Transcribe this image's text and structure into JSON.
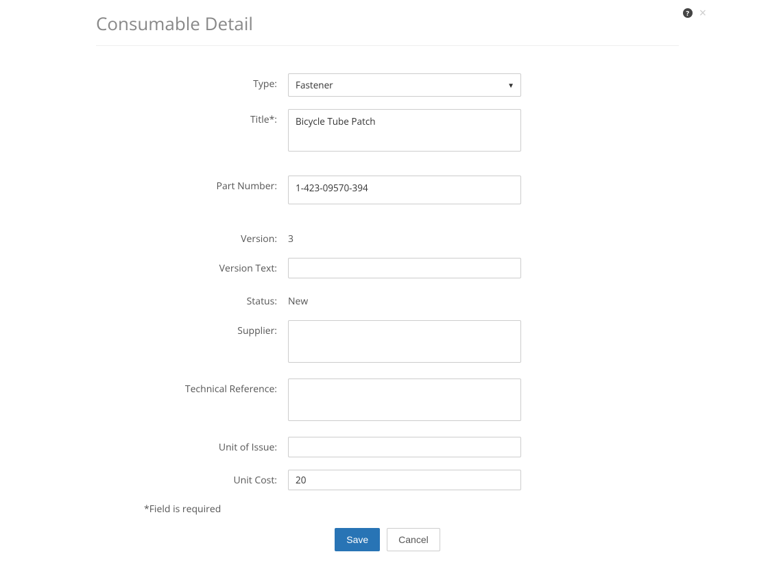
{
  "header": {
    "title": "Consumable Detail"
  },
  "form": {
    "labels": {
      "type": "Type:",
      "title": "Title*:",
      "part_number": "Part Number:",
      "version": "Version:",
      "version_text": "Version Text:",
      "status": "Status:",
      "supplier": "Supplier:",
      "technical_reference": "Technical Reference:",
      "unit_of_issue": "Unit of Issue:",
      "unit_cost": "Unit Cost:"
    },
    "values": {
      "type": "Fastener",
      "title": "Bicycle Tube Patch",
      "part_number": "1-423-09570-394",
      "version": "3",
      "version_text": "",
      "status": "New",
      "supplier": "",
      "technical_reference": "",
      "unit_of_issue": "",
      "unit_cost": "20"
    },
    "required_note": "*Field is required"
  },
  "actions": {
    "save_label": "Save",
    "cancel_label": "Cancel"
  }
}
